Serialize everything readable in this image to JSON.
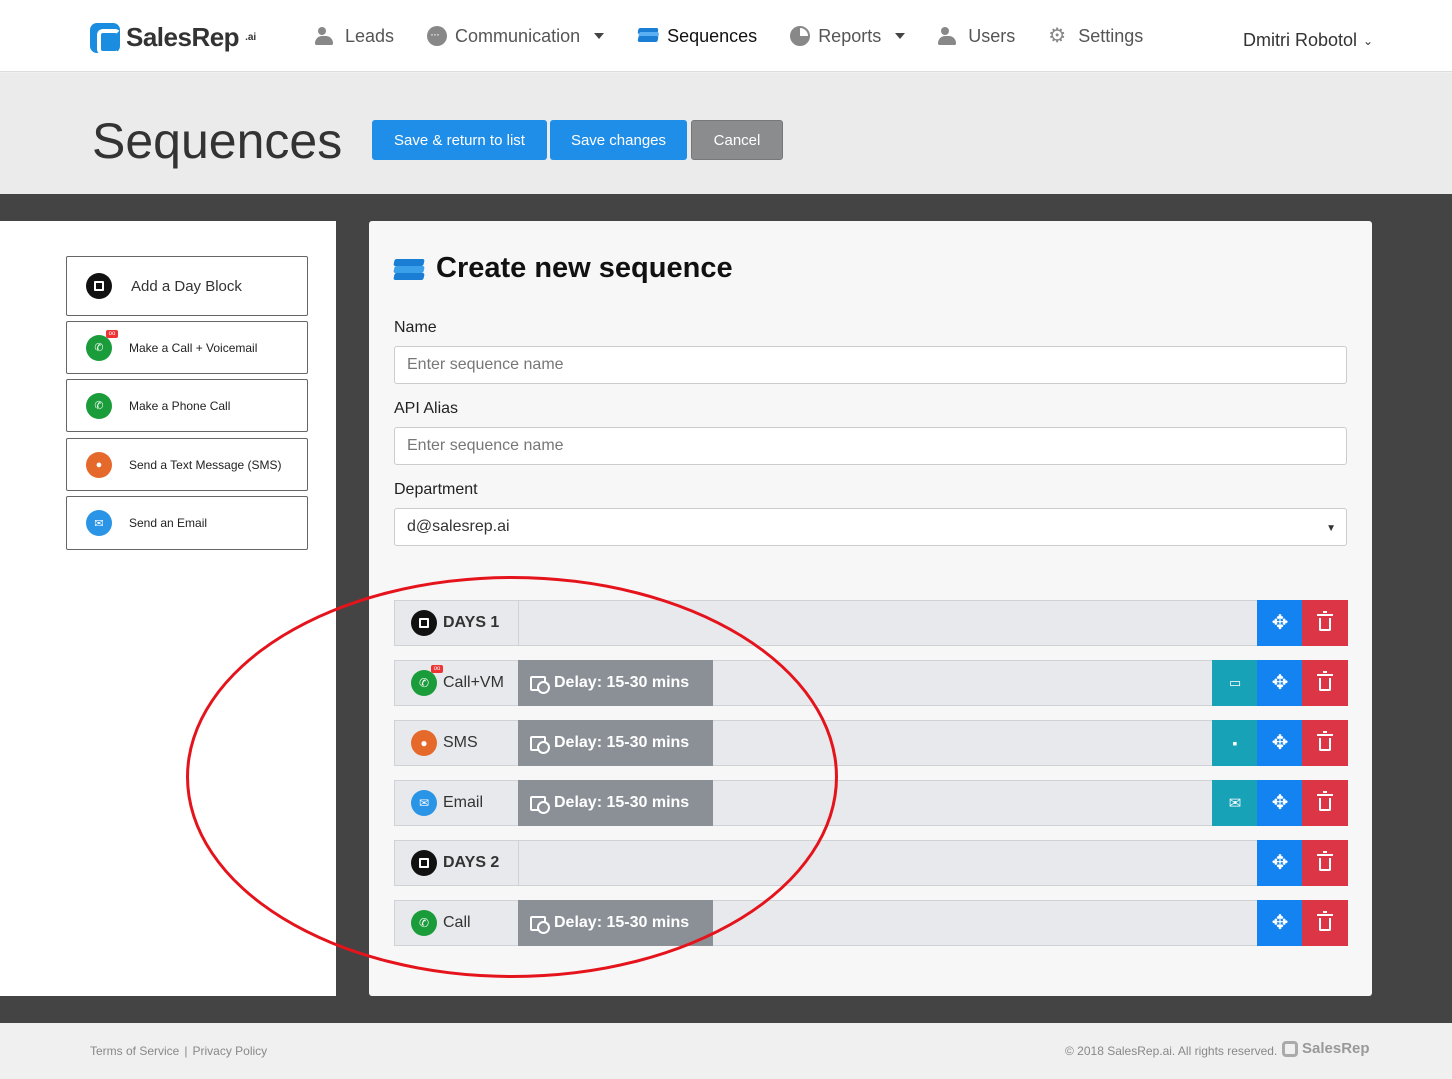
{
  "brand": {
    "name": "SalesRep",
    "suffix": ".ai"
  },
  "nav": {
    "items": [
      {
        "label": "Leads",
        "icon": "users-icon"
      },
      {
        "label": "Communication",
        "icon": "chat-icon",
        "dropdown": true
      },
      {
        "label": "Sequences",
        "icon": "layers-icon",
        "active": true
      },
      {
        "label": "Reports",
        "icon": "pie-chart-icon",
        "dropdown": true
      },
      {
        "label": "Users",
        "icon": "users-icon"
      },
      {
        "label": "Settings",
        "icon": "gear-icon"
      }
    ],
    "user_name": "Dmitri Robotol"
  },
  "header": {
    "title": "Sequences",
    "save_return_label": "Save & return to list",
    "save_label": "Save changes",
    "cancel_label": "Cancel"
  },
  "toolbox": {
    "items": [
      {
        "label": "Add a Day Block",
        "icon": "day-block-icon"
      },
      {
        "label": "Make a Call + Voicemail",
        "icon": "phone-voicemail-icon"
      },
      {
        "label": "Make a Phone Call",
        "icon": "phone-icon"
      },
      {
        "label": "Send a Text Message (SMS)",
        "icon": "sms-icon"
      },
      {
        "label": "Send an Email",
        "icon": "email-icon"
      }
    ]
  },
  "form": {
    "title": "Create new sequence",
    "name_label": "Name",
    "name_placeholder": "Enter sequence name",
    "alias_label": "API Alias",
    "alias_placeholder": "Enter sequence name",
    "department_label": "Department",
    "department_value": "d@salesrep.ai"
  },
  "sequence": {
    "rows": [
      {
        "kind": "day",
        "label": "DAYS 1"
      },
      {
        "kind": "step",
        "label": "Call+VM",
        "delay": "Delay: 15-30 mins",
        "extra": "voicemail-icon"
      },
      {
        "kind": "step",
        "label": "SMS",
        "delay": "Delay: 15-30 mins",
        "extra": "message-icon"
      },
      {
        "kind": "step",
        "label": "Email",
        "delay": "Delay: 15-30 mins",
        "extra": "envelope-icon"
      },
      {
        "kind": "day",
        "label": "DAYS 2"
      },
      {
        "kind": "step",
        "label": "Call",
        "delay": "Delay: 15-30 mins"
      }
    ]
  },
  "colors": {
    "primary": "#1f8ee8",
    "cancel": "#8a8c8e",
    "move": "#1283f0",
    "delete": "#dc3545",
    "extra": "#17a2b8",
    "annotation": "#e5131b"
  },
  "footer": {
    "terms": "Terms of Service",
    "privacy": "Privacy Policy",
    "copyright": "© 2018 SalesRep.ai. All rights reserved.",
    "logo_text": "SalesRep"
  }
}
